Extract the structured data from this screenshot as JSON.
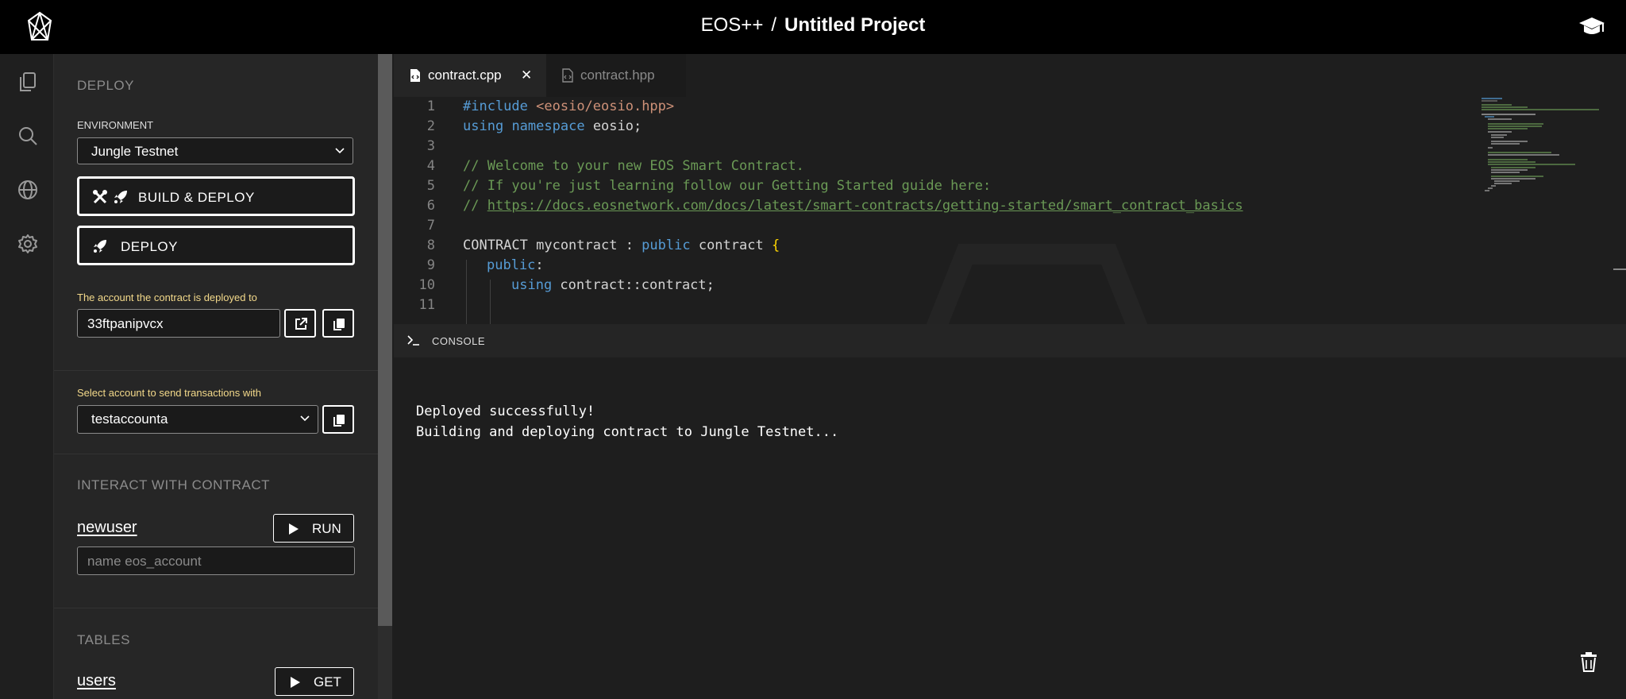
{
  "header": {
    "brand": "EOS++",
    "separator": "/",
    "project": "Untitled Project"
  },
  "activity_bar": [
    "files-icon",
    "search-icon",
    "globe-icon",
    "settings-icon"
  ],
  "deploy": {
    "section_title": "DEPLOY",
    "environment_label": "ENVIRONMENT",
    "environment_value": "Jungle Testnet",
    "build_deploy_label": "BUILD & DEPLOY",
    "deploy_label": "DEPLOY",
    "account_label": "The account the contract is deployed to",
    "account_value": "33ftpanipvcx",
    "sender_label": "Select account to send transactions with",
    "sender_value": "testaccounta"
  },
  "interact": {
    "section_title": "INTERACT WITH CONTRACT",
    "action_name": "newuser",
    "run_label": "RUN",
    "param_placeholder": "name eos_account"
  },
  "tables": {
    "section_title": "TABLES",
    "table_name": "users",
    "get_label": "GET"
  },
  "editor": {
    "tabs": [
      {
        "label": "contract.cpp",
        "active": true
      },
      {
        "label": "contract.hpp",
        "active": false
      }
    ],
    "line_numbers": [
      "1",
      "2",
      "3",
      "4",
      "5",
      "6",
      "7",
      "8",
      "9",
      "10",
      "11"
    ],
    "code": {
      "l1_kw": "#include",
      "l1_str": "<eosio/eosio.hpp>",
      "l2_kw1": "using",
      "l2_kw2": "namespace",
      "l2_rest": "eosio;",
      "l4": "// Welcome to your new EOS Smart Contract.",
      "l5": "// If you're just learning follow our Getting Started guide here:",
      "l6_prefix": "// ",
      "l6_link": "https://docs.eosnetwork.com/docs/latest/smart-contracts/getting-started/smart_contract_basics",
      "l8_a": "CONTRACT mycontract : ",
      "l8_kw": "public",
      "l8_b": " contract ",
      "l8_brace": "{",
      "l9_kw": "public",
      "l9_rest": ":",
      "l10_kw": "using",
      "l10_rest": " contract::contract;"
    }
  },
  "console": {
    "title": "CONSOLE",
    "lines": [
      "Deployed successfully!",
      "Building and deploying contract to Jungle Testnet..."
    ]
  },
  "colors": {
    "background": "#1e1e1e",
    "topbar": "#000000",
    "panel": "#262626",
    "keyword": "#569cd6",
    "string": "#ce9178",
    "comment": "#6a9955",
    "hint_label": "#f3d98a"
  }
}
